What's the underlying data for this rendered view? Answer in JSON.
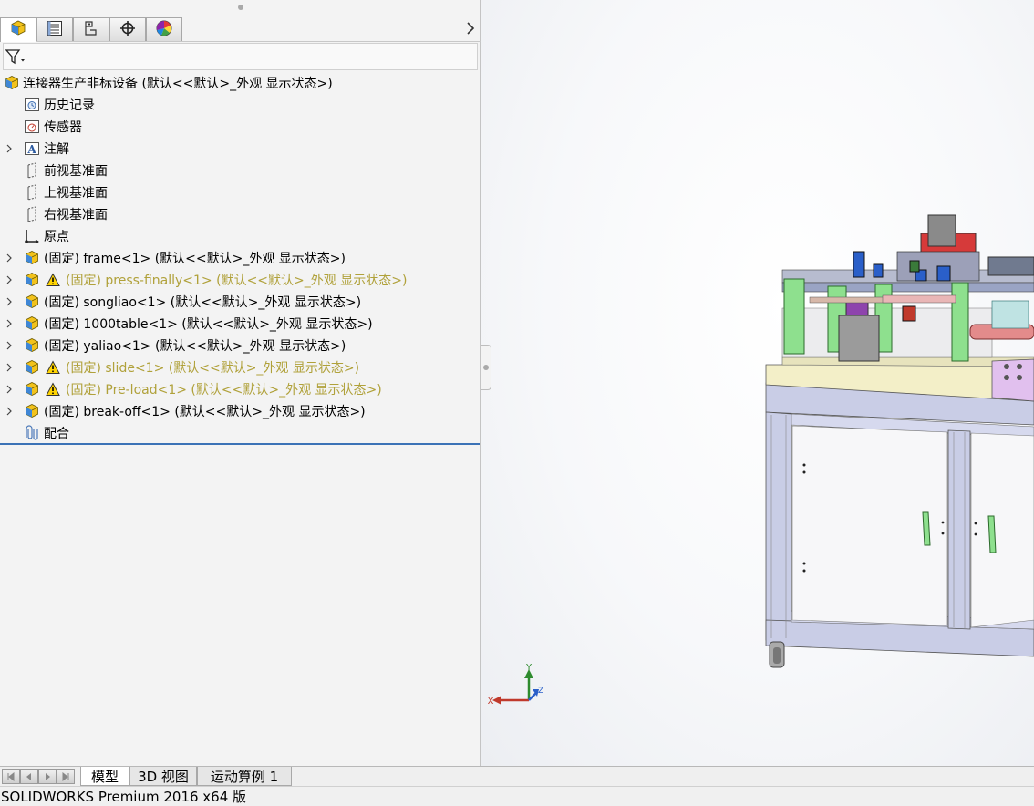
{
  "feature_manager": {
    "tabs": [
      {
        "name": "feature-manager-tab",
        "icon": "assembly-icon",
        "active": true
      },
      {
        "name": "property-manager-tab",
        "icon": "property-list-icon"
      },
      {
        "name": "configuration-manager-tab",
        "icon": "configuration-icon"
      },
      {
        "name": "dimxpert-manager-tab",
        "icon": "crosshair-icon"
      },
      {
        "name": "display-manager-tab",
        "icon": "color-wheel-icon"
      }
    ],
    "filter_icon": "funnel-icon",
    "tree": {
      "root": "连接器生产非标设备  (默认<<默认>_外观 显示状态>)",
      "history": "历史记录",
      "sensors": "传感器",
      "annotations": "注解",
      "front_plane": "前视基准面",
      "top_plane": "上视基准面",
      "right_plane": "右视基准面",
      "origin": "原点",
      "components": [
        {
          "label": "(固定) frame<1> (默认<<默认>_外观 显示状态>)",
          "warning": false
        },
        {
          "label": "(固定) press-finally<1> (默认<<默认>_外观 显示状态>)",
          "warning": true
        },
        {
          "label": "(固定) songliao<1> (默认<<默认>_外观 显示状态>)",
          "warning": false
        },
        {
          "label": "(固定) 1000table<1> (默认<<默认>_外观 显示状态>)",
          "warning": false
        },
        {
          "label": "(固定) yaliao<1> (默认<<默认>_外观 显示状态>)",
          "warning": false
        },
        {
          "label": "(固定) slide<1> (默认<<默认>_外观 显示状态>)",
          "warning": true
        },
        {
          "label": "(固定) Pre-load<1> (默认<<默认>_外观 显示状态>)",
          "warning": true
        },
        {
          "label": "(固定) break-off<1> (默认<<默认>_外观 显示状态>)",
          "warning": false
        }
      ],
      "mates": "配合"
    }
  },
  "triad": {
    "x": "X",
    "y": "Y",
    "z": "Z"
  },
  "bottom_tabs": [
    "模型",
    "3D 视图",
    "运动算例 1"
  ],
  "status_bar": "SOLIDWORKS Premium 2016 x64 版",
  "colors": {
    "warning_text": "#b0a13a",
    "tree_separator": "#3b72b6",
    "frame_blue": "#c9cde6",
    "bracket_green": "#8ee08e",
    "plate_cream": "#f3efc8",
    "block_lilac": "#e1c0ee"
  }
}
